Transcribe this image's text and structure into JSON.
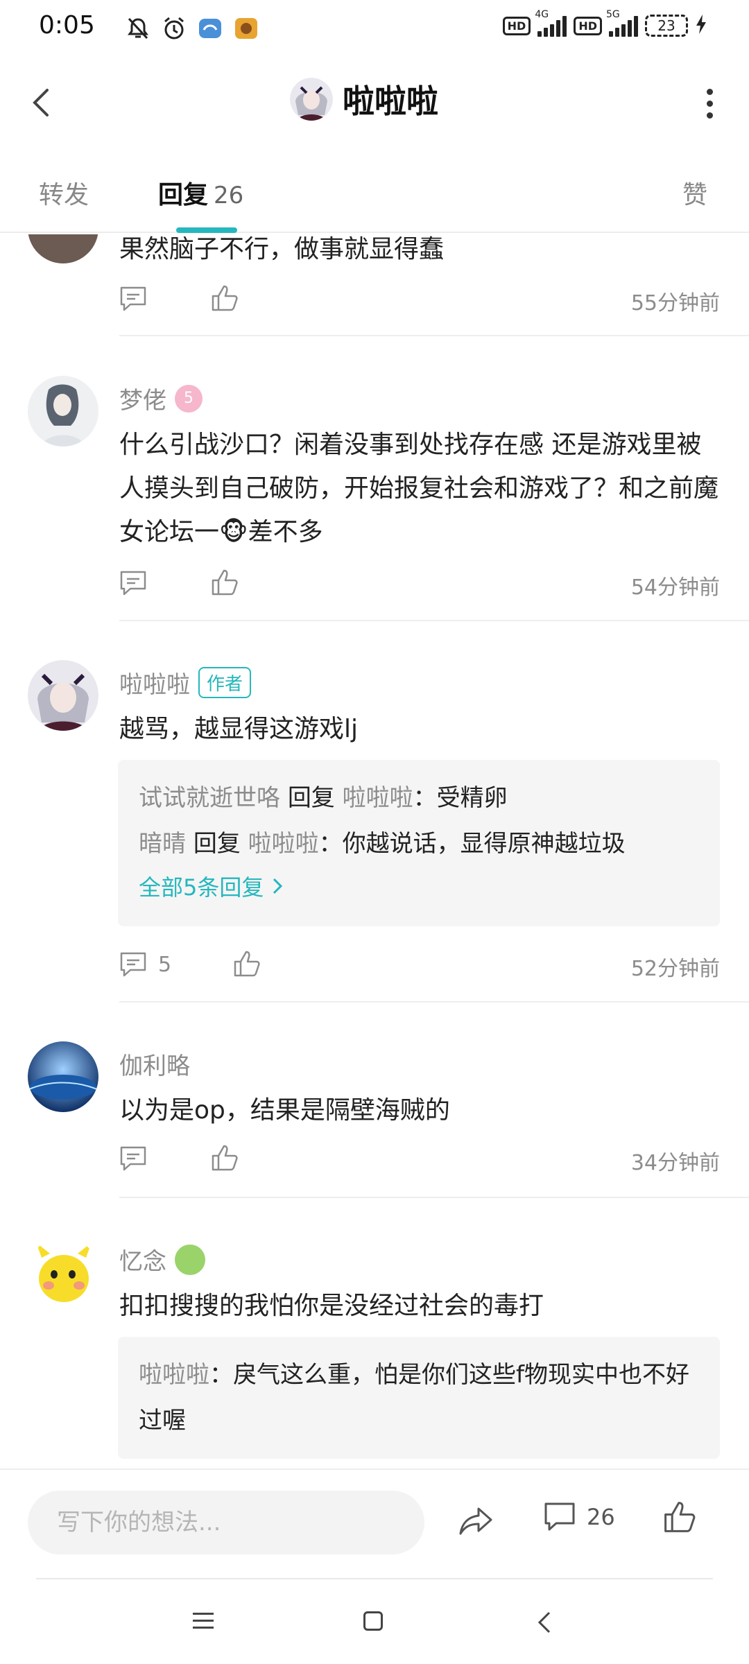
{
  "status_bar": {
    "time": "0:05",
    "hd1": "HD",
    "net1": "4G",
    "hd2": "HD",
    "net2": "5G",
    "battery": "23",
    "icons": [
      "mute-bell-icon",
      "alarm-icon",
      "app-icon",
      "game-icon",
      "signal-icon",
      "battery-icon",
      "charging-icon"
    ]
  },
  "header": {
    "title": "啦啦啦"
  },
  "tabs": {
    "forward": "转发",
    "reply": "回复",
    "reply_count": "26",
    "like": "赞"
  },
  "comments": [
    {
      "text": "果然脑子不行，做事就显得蠢",
      "time": "55分钟前"
    },
    {
      "name": "梦佬",
      "text": "什么引战沙口？闲着没事到处找存在感 还是游戏里被人摸头到自己破防，开始报复社会和游戏了？和之前魔女论坛一🐵差不多",
      "time": "54分钟前"
    },
    {
      "name": "啦啦啦",
      "badge": "作者",
      "text": "越骂，越显得这游戏lj",
      "replies": [
        {
          "from": "试试就逝世咯",
          "verb": "回复",
          "to": "啦啦啦",
          "text": "：受精卵"
        },
        {
          "from": "暗晴",
          "verb": "回复",
          "to": "啦啦啦",
          "text": "：你越说话，显得原神越垃圾"
        }
      ],
      "more": "全部5条回复",
      "reply_count": "5",
      "time": "52分钟前"
    },
    {
      "name": "伽利略",
      "text": "以为是op，结果是隔壁海贼的",
      "time": "34分钟前"
    },
    {
      "name": "忆念",
      "text": "扣扣搜搜的我怕你是没经过社会的毒打",
      "replies": [
        {
          "from": "啦啦啦",
          "text": "：戾气这么重，怕是你们这些f物现实中也不好过喔"
        }
      ]
    }
  ],
  "bottom_bar": {
    "placeholder": "写下你的想法...",
    "comment_count": "26"
  },
  "colors": {
    "accent": "#25b7bd",
    "muted_text": "#8c8c8c",
    "reply_bg": "#f5f5f5"
  }
}
